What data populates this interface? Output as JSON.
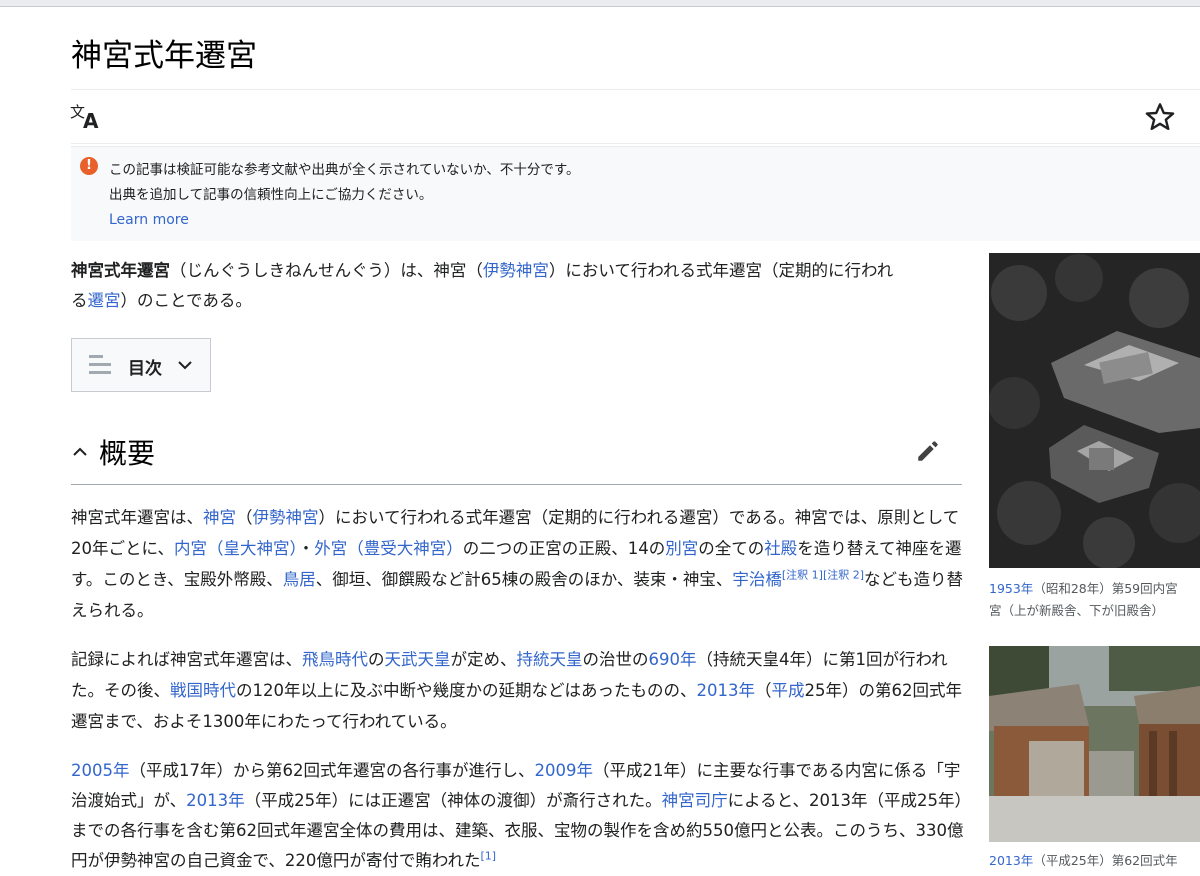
{
  "page": {
    "title": "神宮式年遷宮"
  },
  "notice": {
    "line1": "この記事は検証可能な参考文献や出典が全く示されていないか、不十分です。",
    "line2": "出典を追加して記事の信頼性向上にご協力ください。",
    "link": "Learn more"
  },
  "lead": {
    "bold_term": "神宮式年遷宮",
    "text1": "（じんぐうしきねんせんぐう）は、神宮（",
    "link1": "伊勢神宮",
    "text2": "）において行われる式年遷宮（定期的に行われ",
    "text3": "る",
    "link2": "遷宮",
    "text4": "）のことである。"
  },
  "toc": {
    "label": "目次"
  },
  "section": {
    "title": "概要"
  },
  "para1": {
    "t1": "神宮式年遷宮は、",
    "l1": "神宮",
    "t2": "（",
    "l2": "伊勢神宮",
    "t3": "）において行われる式年遷宮（定期的に行われる遷宮）である。神宮では、原則として20年ごとに、",
    "l3": "内宮（皇大神宮）",
    "t4": "・",
    "l4": "外宮（豊受大神宮）",
    "t5": "の二つの正宮の正殿、14の",
    "l5": "別宮",
    "t6": "の全ての",
    "l6": "社殿",
    "t7": "を造り替えて神座を遷す。このとき、宝殿外幣殿、",
    "l7": "鳥居",
    "t8": "、御垣、御饌殿など計65棟の殿舎のほか、装束・神宝、",
    "l8": "宇治橋",
    "s1": "[注釈 1]",
    "s2": "[注釈 2]",
    "t9": "なども造り替えられる。"
  },
  "para2": {
    "t1": "記録によれば神宮式年遷宮は、",
    "l1": "飛鳥時代",
    "t2": "の",
    "l2": "天武天皇",
    "t3": "が定め、",
    "l3": "持統天皇",
    "t4": "の治世の",
    "l4": "690年",
    "t5": "（持統天皇4年）に第1回が行われた。その後、",
    "l5": "戦国時代",
    "t6": "の120年以上に及ぶ中断や幾度かの延期などはあったものの、",
    "l6": "2013年",
    "t7": "（",
    "l7": "平成",
    "t8": "25年）の第62回式年遷宮まで、およそ1300年にわたって行われている。"
  },
  "para3": {
    "l1": "2005年",
    "t1": "（平成17年）から第62回式年遷宮の各行事が進行し、",
    "l2": "2009年",
    "t2": "（平成21年）に主要な行事である内宮に係る「宇治渡始式」が、",
    "l3": "2013年",
    "t3": "（平成25年）には正遷宮（神体の渡御）が斎行された。",
    "l4": "神宮司庁",
    "t4": "によると、2013年（平成25年）までの各行事を含む第62回式年遷宮全体の費用は、建築、衣服、宝物の製作を含め約550億円と公表。このうち、330億円が伊勢神宮の自己資金で、220億円が寄付で賄われた",
    "s1": "[1]"
  },
  "caption1": {
    "link": "1953年",
    "text1": "（昭和28年）第59回内宮",
    "text2": "宮（上が新殿舎、下が旧殿舎）"
  },
  "caption2": {
    "link": "2013年",
    "text1": "（平成25年）第62回式年"
  },
  "colors": {
    "link": "#3366cc",
    "notice_icon": "#e9612a",
    "notice_bg": "#f8f9fa"
  },
  "icons": {
    "language": "language-icon",
    "watch": "star-icon",
    "toc": "list-icon",
    "edit": "pencil-icon"
  }
}
